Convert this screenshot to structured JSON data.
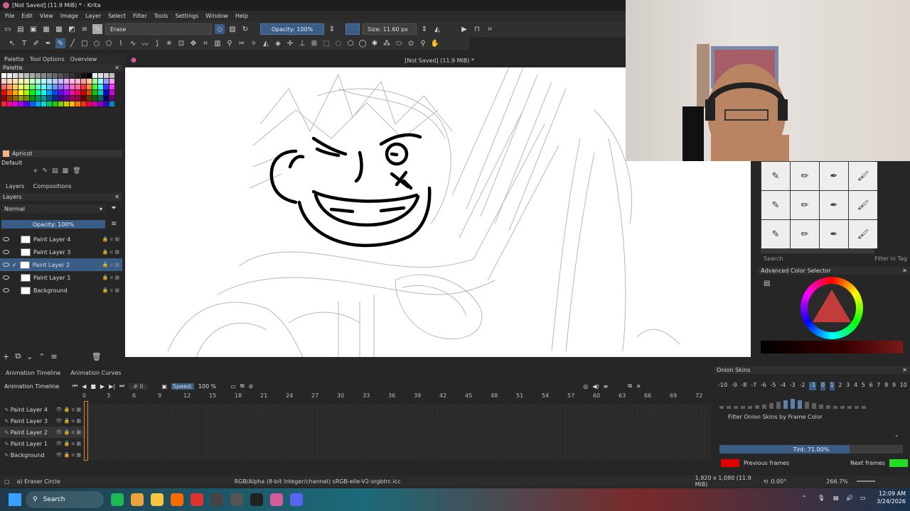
{
  "window": {
    "title": "[Not Saved]  (11.9 MiB)  * - Krita"
  },
  "menu": [
    "File",
    "Edit",
    "View",
    "Image",
    "Layer",
    "Select",
    "Filter",
    "Tools",
    "Settings",
    "Window",
    "Help"
  ],
  "toolbar": {
    "preset_label": "Erase",
    "opacity_label": "Opacity: 100%",
    "size_label": "Size: 11.60 px"
  },
  "left_tabs": [
    "Palette",
    "Tool Options",
    "Overview"
  ],
  "palette": {
    "title": "Palette",
    "selected_color_name": "Apricot",
    "palette_set": "Default"
  },
  "layers_dock": {
    "tabs": [
      "Layers",
      "Compositions"
    ],
    "title": "Layers",
    "blend_mode": "Normal",
    "opacity_label": "Opacity:  100%",
    "layers": [
      {
        "name": "Paint Layer 4",
        "selected": false
      },
      {
        "name": "Paint Layer 3",
        "selected": false
      },
      {
        "name": "Paint Layer 2",
        "selected": true
      },
      {
        "name": "Paint Layer 1",
        "selected": false
      },
      {
        "name": "Background",
        "selected": false
      }
    ]
  },
  "canvas": {
    "title": "[Not Saved]  (11.9 MiB) *"
  },
  "brush_presets": {
    "search_placeholder": "Search",
    "filter_label": "Filter in Tag"
  },
  "color_selector": {
    "title": "Advanced Color Selector"
  },
  "timeline": {
    "tabs": [
      "Animation Timeline",
      "Animation Curves"
    ],
    "title": "Animation Timeline",
    "frame": "0",
    "speed_label": "Speed:",
    "speed_value": "100 %",
    "ruler": [
      "0",
      "3",
      "6",
      "9",
      "12",
      "15",
      "18",
      "21",
      "24",
      "27",
      "30",
      "33",
      "36",
      "39",
      "42",
      "45",
      "48",
      "51",
      "54",
      "57",
      "60",
      "63",
      "66",
      "69",
      "72"
    ],
    "layers": [
      "Paint Layer 4",
      "Paint Layer 3",
      "Paint Layer 2",
      "Paint Layer 1",
      "Background"
    ]
  },
  "onion_skins": {
    "title": "Onion Skins",
    "numbers": [
      "-10",
      "-9",
      "-8",
      "-7",
      "-6",
      "-5",
      "-4",
      "-3",
      "-2",
      "-1",
      "0",
      "1",
      "2",
      "3",
      "4",
      "5",
      "6",
      "7",
      "8",
      "9",
      "10"
    ],
    "filter_label": "Filter Onion Skins by Frame Color",
    "tint_label": "Tint: 71.00%",
    "tint_value": 0.71,
    "previous_label": "Previous frames",
    "next_label": "Next frames",
    "previous_color": "#e00000",
    "next_color": "#22dd22"
  },
  "statusbar": {
    "brush": "a) Eraser Circle",
    "color_space": "RGB/Alpha (8-bit integer/channel)  sRGB-elle-V2-srgbtrc.icc",
    "dimensions": "1,920 x 1,080 (11.9 MiB)",
    "rotation": "0.00°",
    "zoom": "266.7%"
  },
  "taskbar": {
    "search_label": "Search",
    "time": "12:09 AM",
    "date": "3/24/2026"
  },
  "colors": {
    "accent": "#3a5d86",
    "onion_prev": "#e00000",
    "onion_next": "#22dd22"
  }
}
